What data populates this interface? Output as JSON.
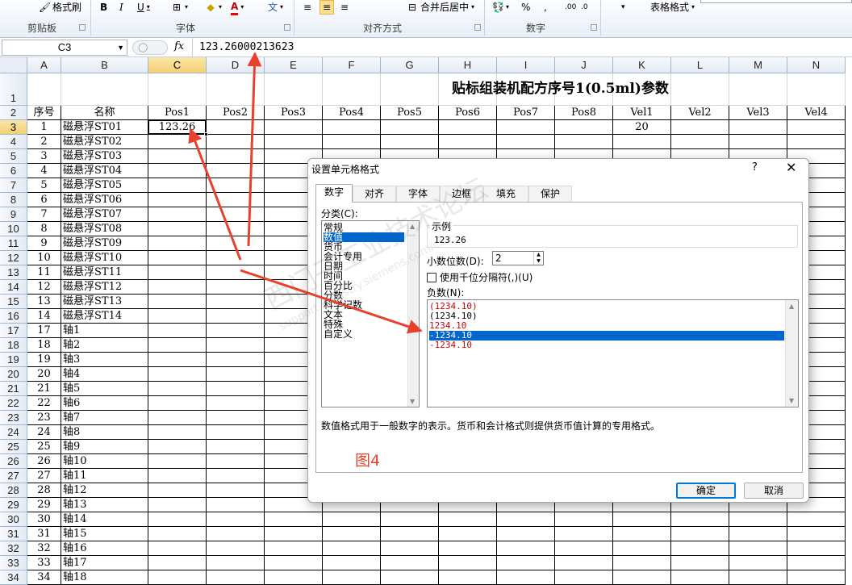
{
  "ribbon": {
    "format_painter_label": "格式刷",
    "bold": "B",
    "italic": "I",
    "underline": "U",
    "font_color_letter": "A",
    "phonetic": "文",
    "merge_center_label": "合并后居中",
    "percent": "%",
    "comma": ",",
    "inc_decimal": ".00",
    "dec_decimal": ".0",
    "table_format_label": "表格格式",
    "groups": {
      "clipboard": "剪贴板",
      "font": "字体",
      "alignment": "对齐方式",
      "number": "数字"
    }
  },
  "formula_bar": {
    "name_box": "C3",
    "fx": "fx",
    "value": "123.26000213623"
  },
  "sheet": {
    "columns": [
      "A",
      "B",
      "C",
      "D",
      "E",
      "F",
      "G",
      "H",
      "I",
      "J",
      "K",
      "L",
      "M",
      "N"
    ],
    "rows": [
      "1",
      "2",
      "3",
      "4",
      "5",
      "6",
      "7",
      "8",
      "9",
      "10",
      "11",
      "12",
      "13",
      "14",
      "15",
      "16",
      "17",
      "18",
      "19",
      "20",
      "21",
      "22",
      "23",
      "24",
      "25",
      "26",
      "27",
      "28",
      "29",
      "30",
      "31",
      "32",
      "33",
      "34"
    ],
    "title": "贴标组装机配方序号1(0.5ml)参数",
    "headers": [
      "序号",
      "名称",
      "Pos1",
      "Pos2",
      "Pos3",
      "Pos4",
      "Pos5",
      "Pos6",
      "Pos7",
      "Pos8",
      "Vel1",
      "Vel2",
      "Vel3",
      "Vel4"
    ],
    "data_rows": [
      {
        "a": "1",
        "b": "磁悬浮ST01",
        "c": "123.26",
        "k": "20"
      },
      {
        "a": "2",
        "b": "磁悬浮ST02"
      },
      {
        "a": "3",
        "b": "磁悬浮ST03"
      },
      {
        "a": "4",
        "b": "磁悬浮ST04"
      },
      {
        "a": "5",
        "b": "磁悬浮ST05"
      },
      {
        "a": "6",
        "b": "磁悬浮ST06"
      },
      {
        "a": "7",
        "b": "磁悬浮ST07"
      },
      {
        "a": "8",
        "b": "磁悬浮ST08"
      },
      {
        "a": "9",
        "b": "磁悬浮ST09"
      },
      {
        "a": "10",
        "b": "磁悬浮ST10"
      },
      {
        "a": "11",
        "b": "磁悬浮ST11"
      },
      {
        "a": "12",
        "b": "磁悬浮ST12"
      },
      {
        "a": "13",
        "b": "磁悬浮ST13"
      },
      {
        "a": "14",
        "b": "磁悬浮ST14"
      },
      {
        "a": "17",
        "b": "轴1"
      },
      {
        "a": "18",
        "b": "轴2"
      },
      {
        "a": "19",
        "b": "轴3"
      },
      {
        "a": "20",
        "b": "轴4"
      },
      {
        "a": "21",
        "b": "轴5"
      },
      {
        "a": "22",
        "b": "轴6"
      },
      {
        "a": "23",
        "b": "轴7"
      },
      {
        "a": "24",
        "b": "轴8"
      },
      {
        "a": "25",
        "b": "轴9"
      },
      {
        "a": "26",
        "b": "轴10"
      },
      {
        "a": "27",
        "b": "轴11"
      },
      {
        "a": "28",
        "b": "轴12"
      },
      {
        "a": "29",
        "b": "轴13"
      },
      {
        "a": "30",
        "b": "轴14"
      },
      {
        "a": "31",
        "b": "轴15"
      },
      {
        "a": "32",
        "b": "轴16"
      },
      {
        "a": "33",
        "b": "轴17"
      },
      {
        "a": "34",
        "b": "轴18"
      }
    ]
  },
  "dialog": {
    "title": "设置单元格格式",
    "help": "?",
    "close": "✕",
    "tabs": [
      "数字",
      "对齐",
      "字体",
      "边框",
      "填充",
      "保护"
    ],
    "category_label": "分类(C):",
    "categories": [
      "常规",
      "数值",
      "货币",
      "会计专用",
      "日期",
      "时间",
      "百分比",
      "分数",
      "科学记数",
      "文本",
      "特殊",
      "自定义"
    ],
    "selected_category": "数值",
    "sample_label": "示例",
    "sample_value": "123.26",
    "decimal_label": "小数位数(D):",
    "decimal_value": "2",
    "thousands_label": "使用千位分隔符(,)(U)",
    "thousands_checked": false,
    "negative_label": "负数(N):",
    "negative_formats": [
      {
        "text": "(1234.10)",
        "red": true
      },
      {
        "text": "(1234.10)",
        "red": false
      },
      {
        "text": "1234.10",
        "red": true
      },
      {
        "text": "-1234.10",
        "red": false,
        "selected": true
      },
      {
        "text": "-1234.10",
        "red": true
      }
    ],
    "description": "数值格式用于一般数字的表示。货币和会计格式则提供货币值计算的专用格式。",
    "figure_label": "图4",
    "ok": "确定",
    "cancel": "取消"
  },
  "watermark": {
    "line1": "西门子工业技术论坛",
    "line2": "support.industry.siemens.com/cs"
  },
  "colors": {
    "annotation_red": "#e8412e",
    "selection_blue": "#0066cc",
    "negative_red": "#d00000"
  }
}
